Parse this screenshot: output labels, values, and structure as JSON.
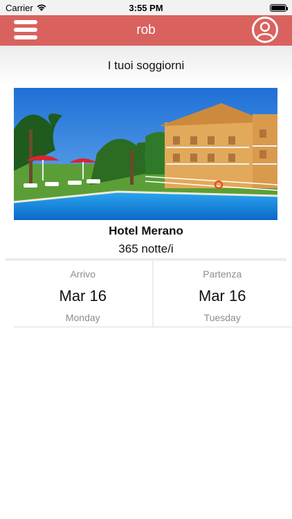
{
  "status_bar": {
    "carrier": "Carrier",
    "time": "3:55 PM"
  },
  "header": {
    "title": "rob",
    "menu_icon": "hamburger-menu-icon",
    "profile_icon": "user-profile-icon",
    "color": "#d9625e"
  },
  "page": {
    "section_title": "I tuoi soggiorni"
  },
  "stay": {
    "hotel_name": "Hotel Merano",
    "nights": "365 notte/i",
    "arrival": {
      "label": "Arrivo",
      "date": "Mar 16",
      "day": "Monday"
    },
    "departure": {
      "label": "Partenza",
      "date": "Mar 16",
      "day": "Tuesday"
    }
  }
}
